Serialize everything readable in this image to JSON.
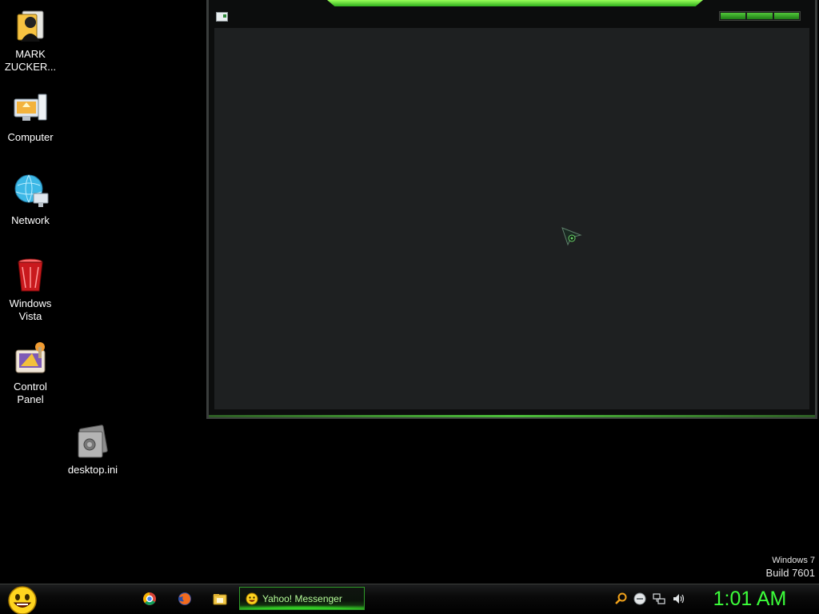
{
  "desktop_icons": [
    {
      "label": "MARK\nZUCKER...",
      "icon": "user-folder-icon"
    },
    {
      "label": "Computer",
      "icon": "computer-icon"
    },
    {
      "label": "Network",
      "icon": "network-icon"
    },
    {
      "label": "Windows\nVista",
      "icon": "recycle-bin-icon"
    },
    {
      "label": "Control\nPanel",
      "icon": "control-panel-icon"
    },
    {
      "label": "desktop.ini",
      "icon": "settings-file-icon"
    }
  ],
  "watermark": {
    "os": "Windows 7",
    "build": "Build 7601"
  },
  "taskbar": {
    "quick_launch": [
      "chrome-icon",
      "firefox-icon",
      "explorer-folder-icon"
    ],
    "active_task": {
      "label": "Yahoo! Messenger",
      "icon": "yahoo-smiley-icon"
    },
    "tray_icons": [
      "search-icon",
      "messenger-status-icon",
      "network-tray-icon",
      "volume-icon"
    ],
    "clock": "1:01 AM"
  },
  "colors": {
    "accent": "#3cff3a",
    "window_client": "#1e2021",
    "background": "#000000"
  }
}
